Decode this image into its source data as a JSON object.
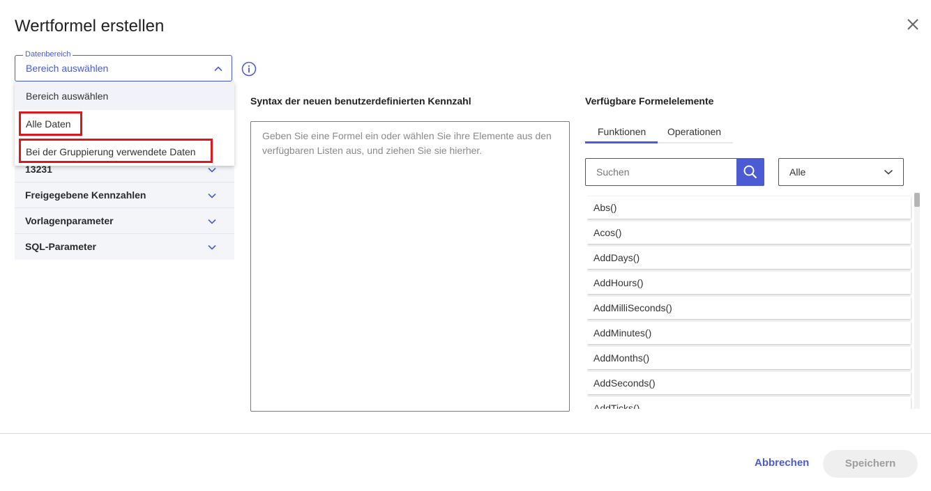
{
  "dialog": {
    "title": "Wertformel erstellen"
  },
  "datenbereich": {
    "legend": "Datenbereich",
    "value": "Bereich auswählen",
    "options": [
      "Bereich auswählen",
      "Alle Daten",
      "Bei der Gruppierung verwendete Daten"
    ]
  },
  "left_sections": [
    {
      "label": "13231"
    },
    {
      "label": "Freigegebene Kennzahlen"
    },
    {
      "label": "Vorlagenparameter"
    },
    {
      "label": "SQL-Parameter"
    }
  ],
  "syntax": {
    "label": "Syntax der neuen benutzerdefinierten Kennzahl",
    "placeholder": "Geben Sie eine Formel ein oder wählen Sie ihre Elemente aus den verfügbaren Listen aus, und ziehen Sie sie hierher."
  },
  "formula": {
    "label": "Verfügbare Formelelemente",
    "tabs": [
      "Funktionen",
      "Operationen"
    ],
    "active_tab": "Funktionen",
    "search_placeholder": "Suchen",
    "filter_value": "Alle",
    "functions": [
      "Abs()",
      "Acos()",
      "AddDays()",
      "AddHours()",
      "AddMilliSeconds()",
      "AddMinutes()",
      "AddMonths()",
      "AddSeconds()",
      "AddTicks()"
    ]
  },
  "footer": {
    "cancel": "Abbrechen",
    "save": "Speichern"
  },
  "colors": {
    "accent": "#4a5bd4",
    "highlight": "#e0161e"
  }
}
